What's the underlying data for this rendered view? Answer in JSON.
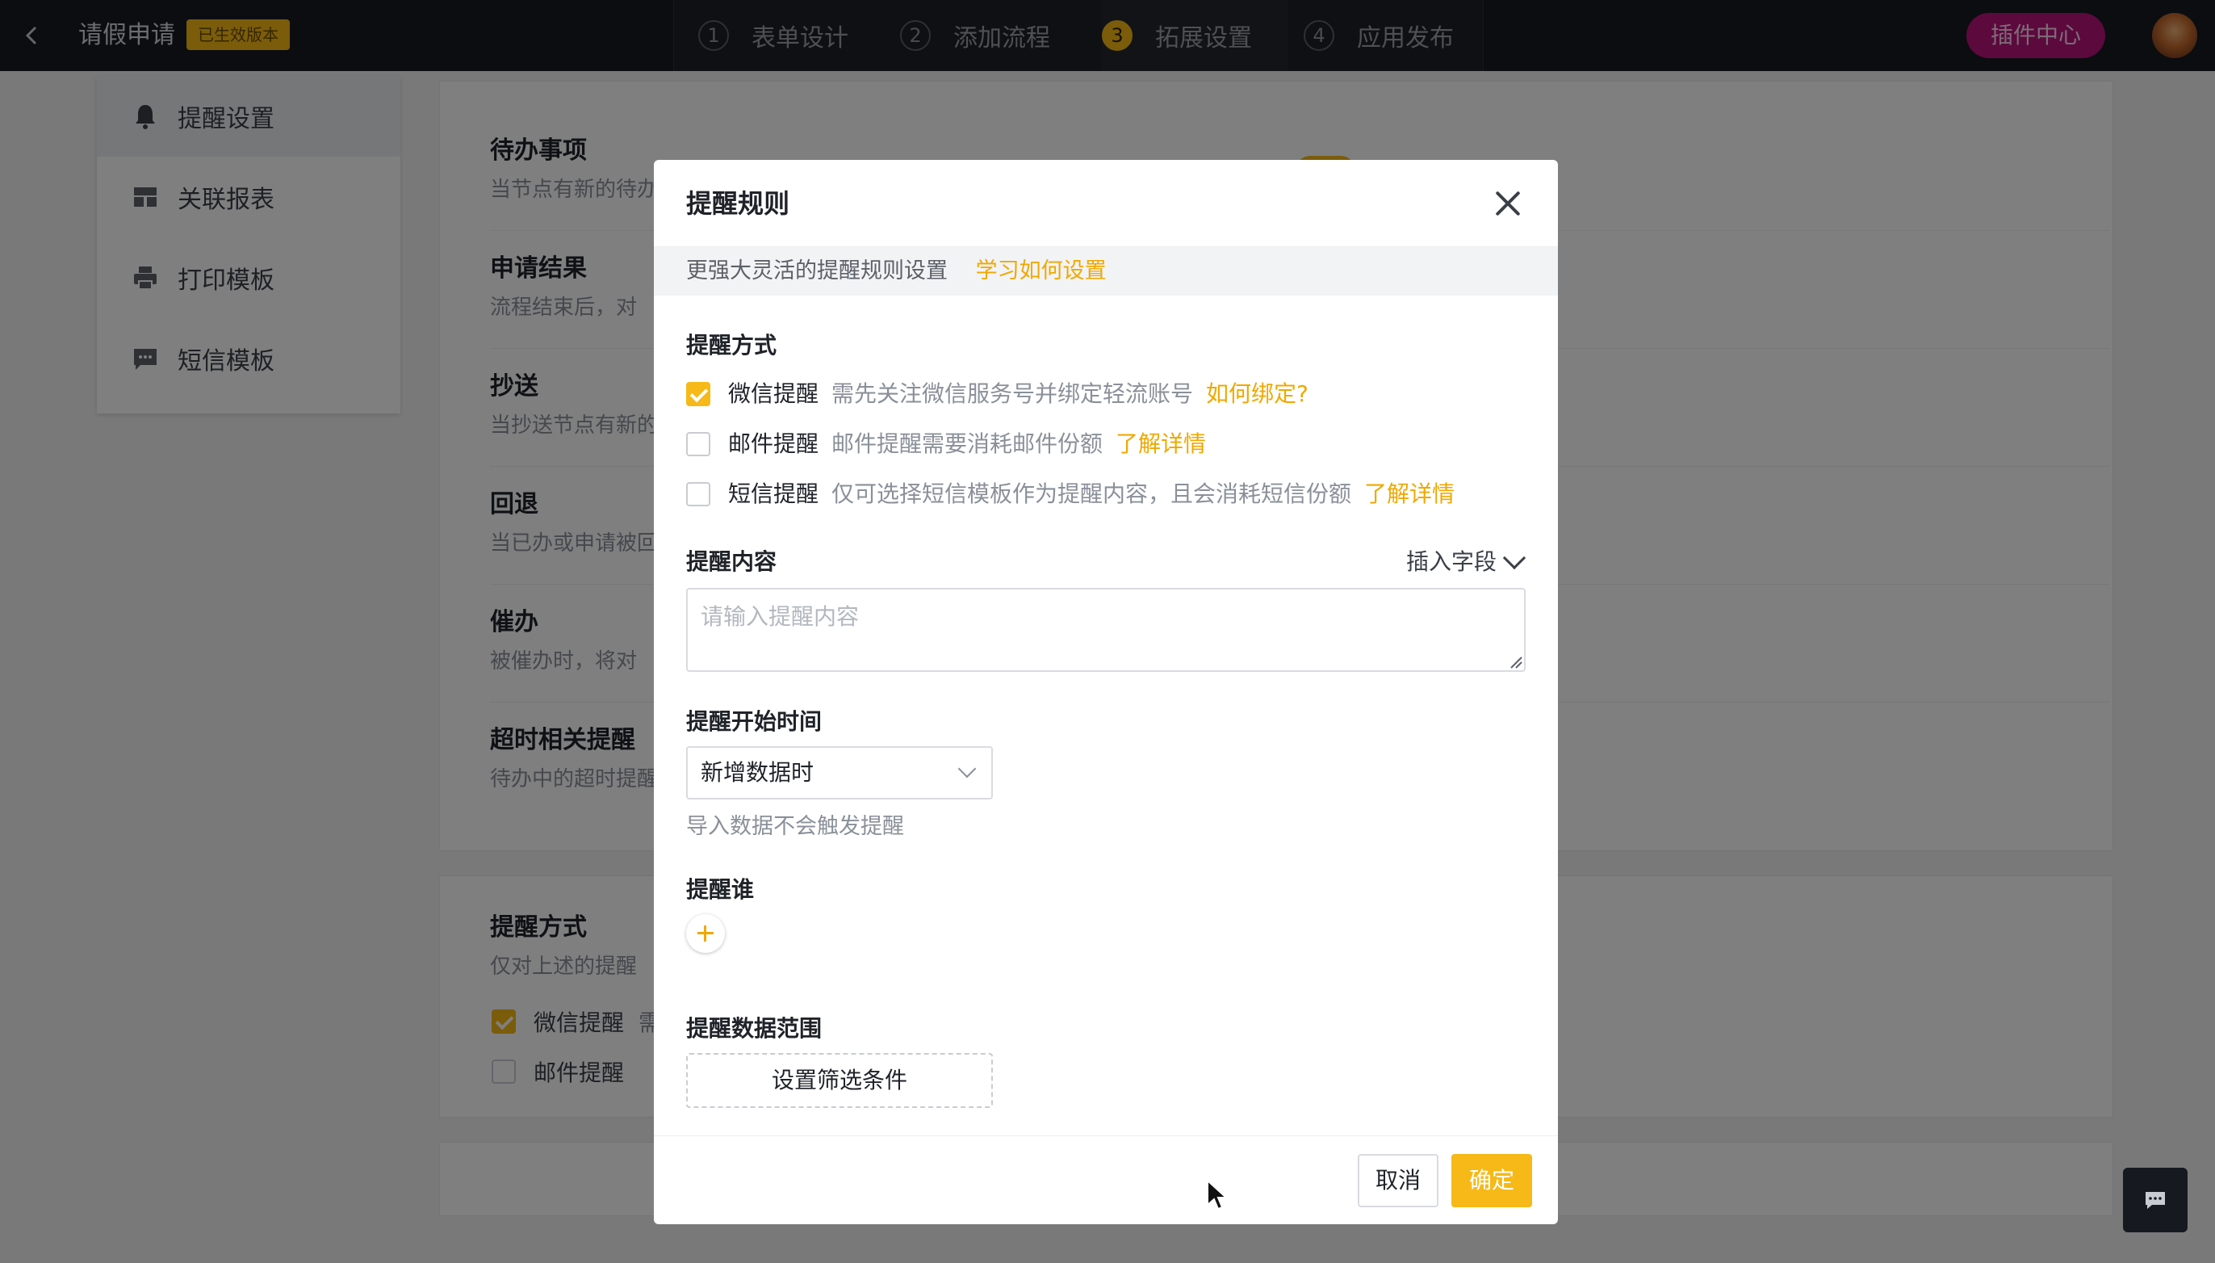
{
  "topbar": {
    "title": "请假申请",
    "badge": "已生效版本",
    "steps": [
      {
        "num": "1",
        "label": "表单设计"
      },
      {
        "num": "2",
        "label": "添加流程"
      },
      {
        "num": "3",
        "label": "拓展设置"
      },
      {
        "num": "4",
        "label": "应用发布"
      }
    ],
    "plugin_label": "插件中心"
  },
  "leftnav": {
    "items": [
      {
        "label": "提醒设置",
        "icon": "bell-icon"
      },
      {
        "label": "关联报表",
        "icon": "report-icon"
      },
      {
        "label": "打印模板",
        "icon": "printer-icon"
      },
      {
        "label": "短信模板",
        "icon": "sms-icon"
      }
    ]
  },
  "content": {
    "sections": [
      {
        "title": "待办事项",
        "desc": "当节点有新的待办"
      },
      {
        "title": "申请结果",
        "desc": "流程结束后，对"
      },
      {
        "title": "抄送",
        "desc": "当抄送节点有新的"
      },
      {
        "title": "回退",
        "desc": "当已办或申请被回"
      },
      {
        "title": "催办",
        "desc": "被催办时，将对"
      },
      {
        "title": "超时相关提醒",
        "desc": "待办中的超时提醒"
      }
    ],
    "methods": {
      "title": "提醒方式",
      "desc": "仅对上述的提醒",
      "wechat": "微信提醒",
      "wechat_hint": "需",
      "email": "邮件提醒"
    }
  },
  "modal": {
    "title": "提醒规则",
    "banner": "更强大灵活的提醒规则设置",
    "banner_link": "学习如何设置",
    "method_label": "提醒方式",
    "methods": [
      {
        "name": "微信提醒",
        "hint": "需先关注微信服务号并绑定轻流账号",
        "link": "如何绑定?",
        "checked": true
      },
      {
        "name": "邮件提醒",
        "hint": "邮件提醒需要消耗邮件份额",
        "link": "了解详情",
        "checked": false
      },
      {
        "name": "短信提醒",
        "hint": "仅可选择短信模板作为提醒内容，且会消耗短信份额",
        "link": "了解详情",
        "checked": false
      }
    ],
    "content_label": "提醒内容",
    "insert_field": "插入字段",
    "content_placeholder": "请输入提醒内容",
    "start_time_label": "提醒开始时间",
    "start_time_value": "新增数据时",
    "start_time_note": "导入数据不会触发提醒",
    "who_label": "提醒谁",
    "range_label": "提醒数据范围",
    "filter_button": "设置筛选条件",
    "cancel": "取消",
    "confirm": "确定"
  },
  "colors": {
    "accent": "#f7b917",
    "link": "#f0a800",
    "topbar": "#161a20",
    "plugin": "#b8137c"
  }
}
